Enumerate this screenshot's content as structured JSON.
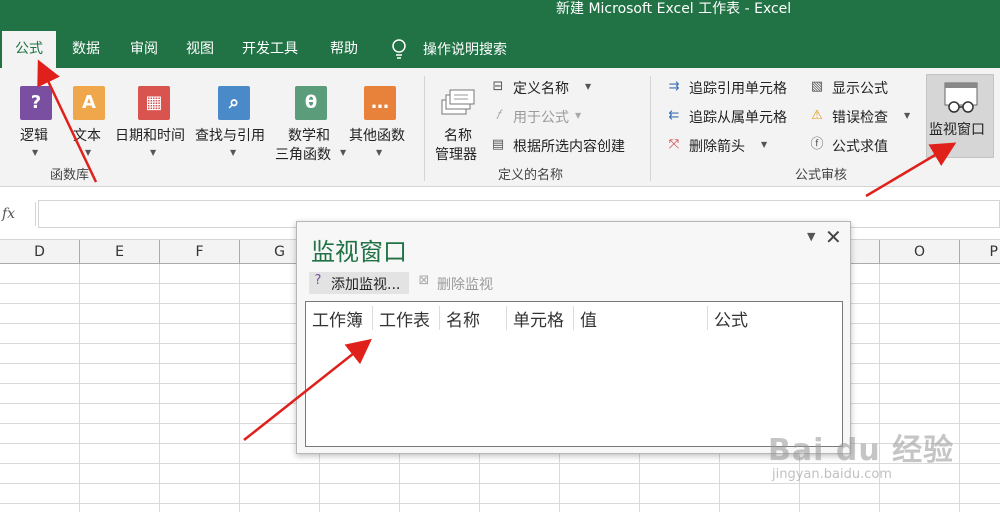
{
  "window": {
    "title": "新建 Microsoft Excel 工作表  -  Excel"
  },
  "tabs": [
    {
      "label": "公式",
      "active": true
    },
    {
      "label": "数据"
    },
    {
      "label": "审阅"
    },
    {
      "label": "视图"
    },
    {
      "label": "开发工具"
    },
    {
      "label": "帮助"
    }
  ],
  "tell_me": {
    "label": "操作说明搜索",
    "icon": "lightbulb-icon"
  },
  "ribbon": {
    "function_library": {
      "label": "函数库",
      "buttons": [
        {
          "label": "逻辑",
          "icon": "logical-icon",
          "glyph": "?",
          "color": "#7a4fa1"
        },
        {
          "label": "文本",
          "icon": "text-icon",
          "glyph": "A",
          "color": "#f0a64a"
        },
        {
          "label": "日期和时间",
          "icon": "date-time-icon",
          "glyph": "▦",
          "color": "#d9534f"
        },
        {
          "label": "查找与引用",
          "icon": "lookup-icon",
          "glyph": "⌕",
          "color": "#4a8ac9"
        },
        {
          "label": "数学和",
          "label2": "三角函数",
          "icon": "math-trig-icon",
          "glyph": "θ",
          "color": "#5b9c7a"
        },
        {
          "label": "其他函数",
          "icon": "more-functions-icon",
          "glyph": "…",
          "color": "#e8823a"
        }
      ]
    },
    "defined_names": {
      "label": "定义的名称",
      "name_manager": {
        "label": "名称",
        "label2": "管理器",
        "icon": "name-manager-icon"
      },
      "define_name": {
        "label": "定义名称",
        "icon": "define-name-icon"
      },
      "use_in_formula": {
        "label": "用于公式",
        "icon": "use-in-formula-icon"
      },
      "create_from_selection": {
        "label": "根据所选内容创建",
        "icon": "create-from-selection-icon"
      }
    },
    "formula_auditing": {
      "label": "公式审核",
      "trace_precedents": {
        "label": "追踪引用单元格",
        "icon": "trace-precedents-icon"
      },
      "trace_dependents": {
        "label": "追踪从属单元格",
        "icon": "trace-dependents-icon"
      },
      "remove_arrows": {
        "label": "删除箭头",
        "icon": "remove-arrows-icon"
      },
      "show_formulas": {
        "label": "显示公式",
        "icon": "show-formulas-icon"
      },
      "error_checking": {
        "label": "错误检查",
        "icon": "error-checking-icon"
      },
      "evaluate_formula": {
        "label": "公式求值",
        "icon": "evaluate-formula-icon"
      },
      "watch_window": {
        "label": "监视窗口",
        "icon": "watch-window-icon"
      }
    }
  },
  "formula_bar": {
    "fx": "fx",
    "value": ""
  },
  "columns": [
    "D",
    "E",
    "F",
    "G",
    "O",
    "P"
  ],
  "watch_window": {
    "title": "监视窗口",
    "add_watch": {
      "label": "添加监视...",
      "icon": "add-watch-icon"
    },
    "delete_watch": {
      "label": "删除监视",
      "icon": "delete-watch-icon"
    },
    "table_headers": [
      "工作簿",
      "工作表",
      "名称",
      "单元格",
      "值",
      "公式"
    ]
  },
  "watermark": {
    "main": "Bai du 经验",
    "sub": "jingyan.baidu.com"
  },
  "colors": {
    "accent": "#217346",
    "ribbon_bg": "#f3f3f3",
    "annotation": "#e0201a"
  }
}
